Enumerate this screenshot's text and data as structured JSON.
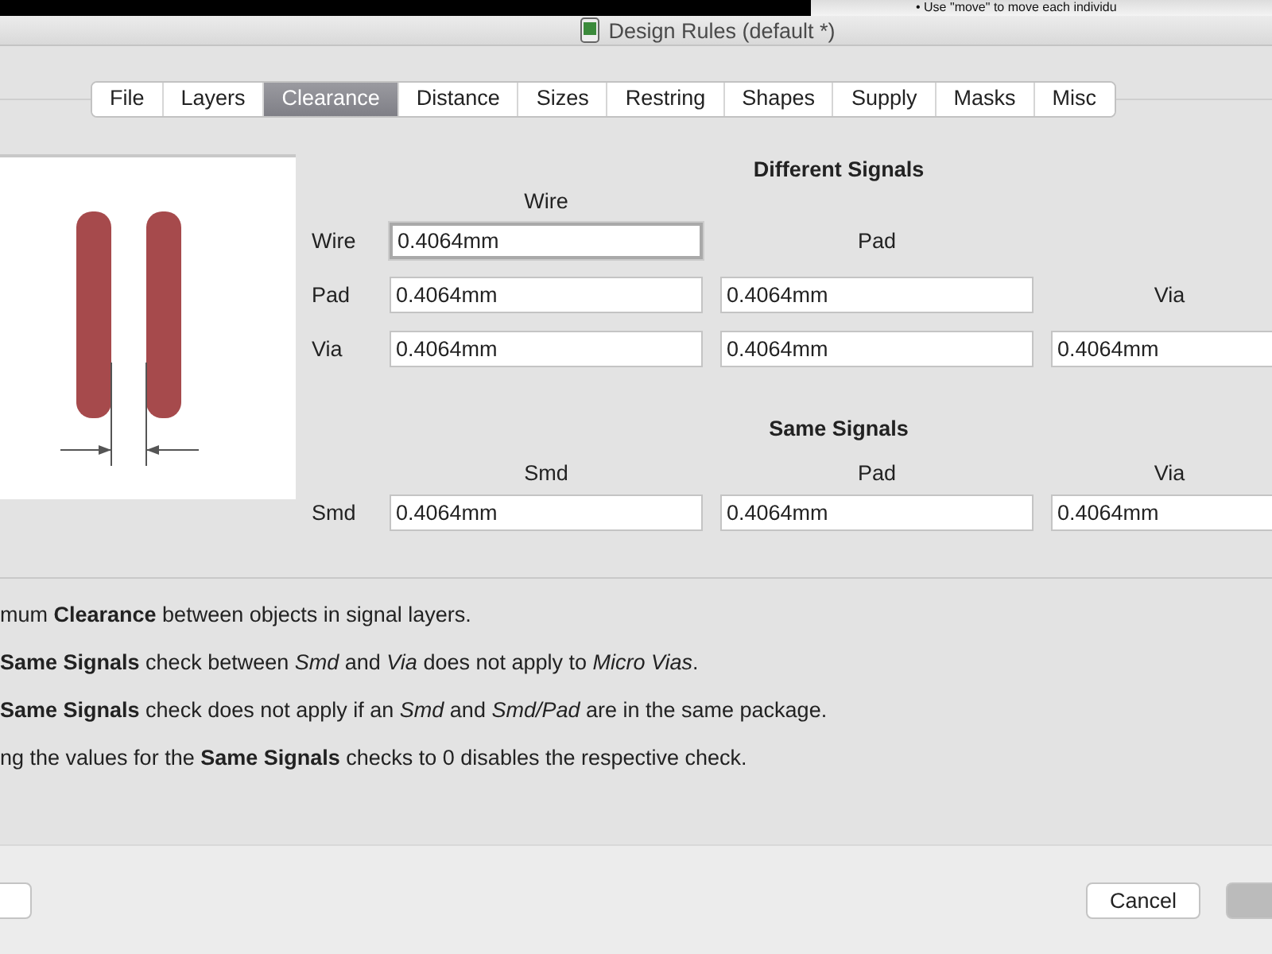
{
  "background_window": {
    "note": "• Use \"move\" to move each individu"
  },
  "window": {
    "title": "Design Rules (default *)"
  },
  "tabs": [
    {
      "label": "File",
      "selected": false
    },
    {
      "label": "Layers",
      "selected": false
    },
    {
      "label": "Clearance",
      "selected": true
    },
    {
      "label": "Distance",
      "selected": false
    },
    {
      "label": "Sizes",
      "selected": false
    },
    {
      "label": "Restring",
      "selected": false
    },
    {
      "label": "Shapes",
      "selected": false
    },
    {
      "label": "Supply",
      "selected": false
    },
    {
      "label": "Masks",
      "selected": false
    },
    {
      "label": "Misc",
      "selected": false
    }
  ],
  "different_signals": {
    "title": "Different Signals",
    "column_headers": [
      "Wire",
      "Pad",
      "Via"
    ],
    "rows": [
      {
        "label": "Wire",
        "values": [
          {
            "value": "0.4064mm",
            "focused": true
          }
        ]
      },
      {
        "label": "Pad",
        "values": [
          {
            "value": "0.4064mm",
            "focused": false
          },
          {
            "value": "0.4064mm",
            "focused": false
          }
        ]
      },
      {
        "label": "Via",
        "values": [
          {
            "value": "0.4064mm",
            "focused": false
          },
          {
            "value": "0.4064mm",
            "focused": false
          },
          {
            "value": "0.4064mm",
            "focused": false
          }
        ]
      }
    ]
  },
  "same_signals": {
    "title": "Same Signals",
    "column_headers": [
      "Smd",
      "Pad",
      "Via"
    ],
    "rows": [
      {
        "label": "Smd",
        "values": [
          {
            "value": "0.4064mm",
            "focused": false
          },
          {
            "value": "0.4064mm",
            "focused": false
          },
          {
            "value": "0.4064mm",
            "focused": false
          }
        ]
      }
    ]
  },
  "notes": [
    "mum **Clearance** between objects in signal layers.",
    "**Same Signals** check between *Smd* and *Via* does not apply to *Micro Vias*.",
    "**Same Signals** check does not apply if an *Smd* and *Smd/Pad* are in the same package.",
    "ng the values for the **Same Signals** checks to 0 disables the respective check."
  ],
  "buttons": [
    {
      "label": "Cancel"
    }
  ]
}
